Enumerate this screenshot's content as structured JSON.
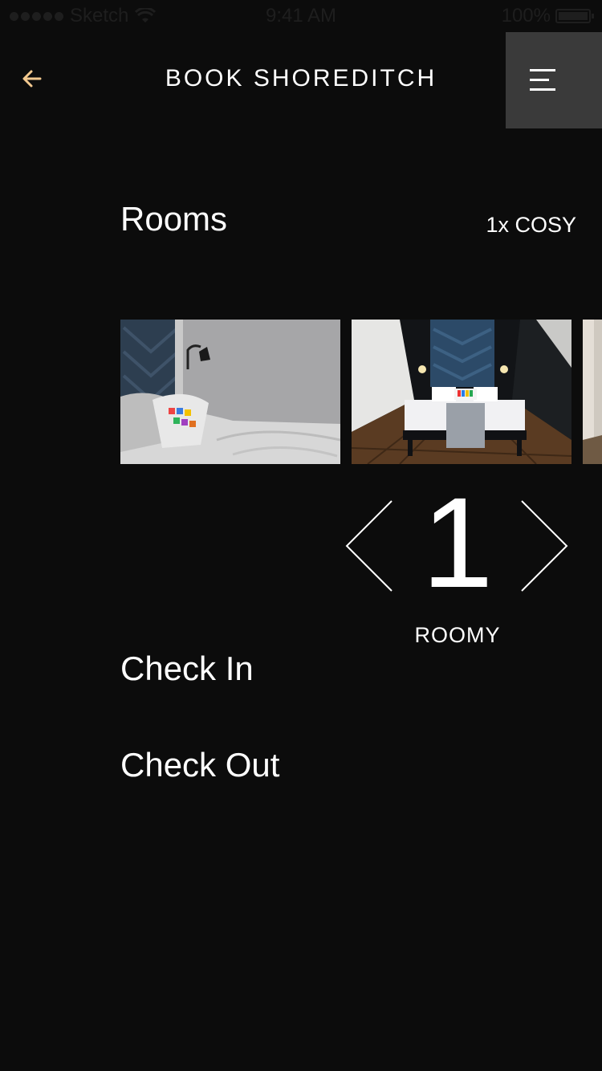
{
  "status_bar": {
    "carrier": "Sketch",
    "time": "9:41 AM",
    "battery": "100%"
  },
  "header": {
    "title": "BOOK SHOREDITCH"
  },
  "colors": {
    "background": "#0c0c0c",
    "accent": "#f3c98f",
    "menu_background": "#3a3a3a"
  },
  "rooms": {
    "title": "Rooms",
    "summary": "1x COSY"
  },
  "room_stepper": {
    "value": "1",
    "room_type": "ROOMY"
  },
  "check_in": {
    "title": "Check In"
  },
  "check_out": {
    "title": "Check Out"
  }
}
